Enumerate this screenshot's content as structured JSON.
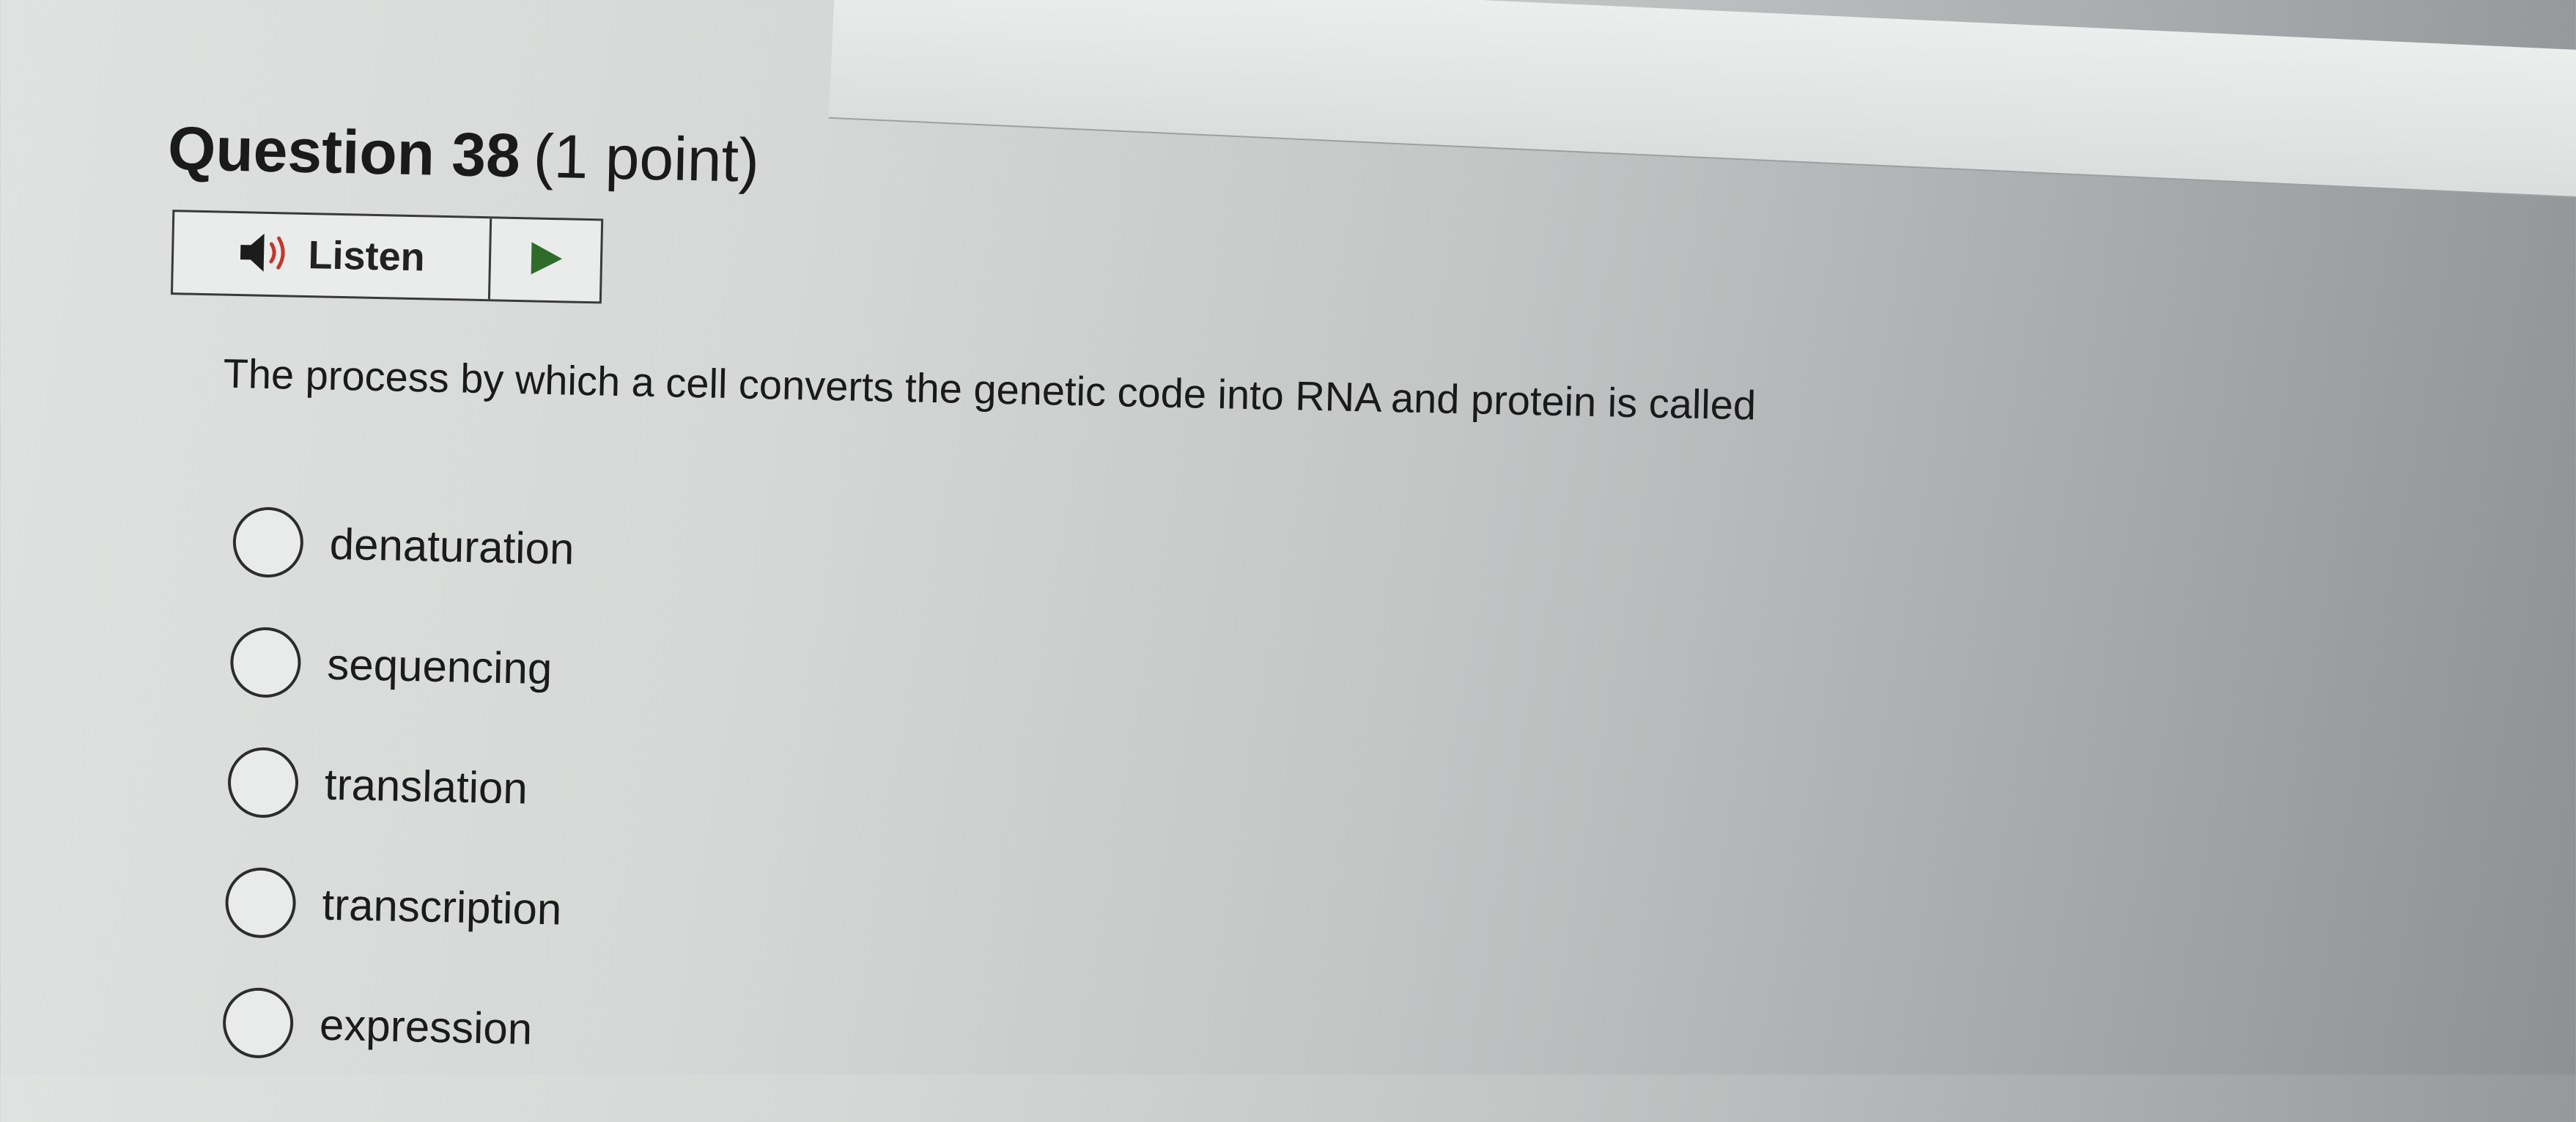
{
  "question": {
    "number": "Question 38",
    "points": "(1 point)",
    "text": "The process by which a cell converts the genetic code into RNA and protein is called"
  },
  "listen": {
    "label": "Listen",
    "speaker_icon": "speaker-icon",
    "play_icon": "play-icon",
    "play_color": "#2f6b2b",
    "speaker_wave_color": "#c0392b"
  },
  "options": [
    {
      "label": "denaturation",
      "selected": false
    },
    {
      "label": "sequencing",
      "selected": false
    },
    {
      "label": "translation",
      "selected": false
    },
    {
      "label": "transcription",
      "selected": false
    },
    {
      "label": "expression",
      "selected": false
    }
  ]
}
